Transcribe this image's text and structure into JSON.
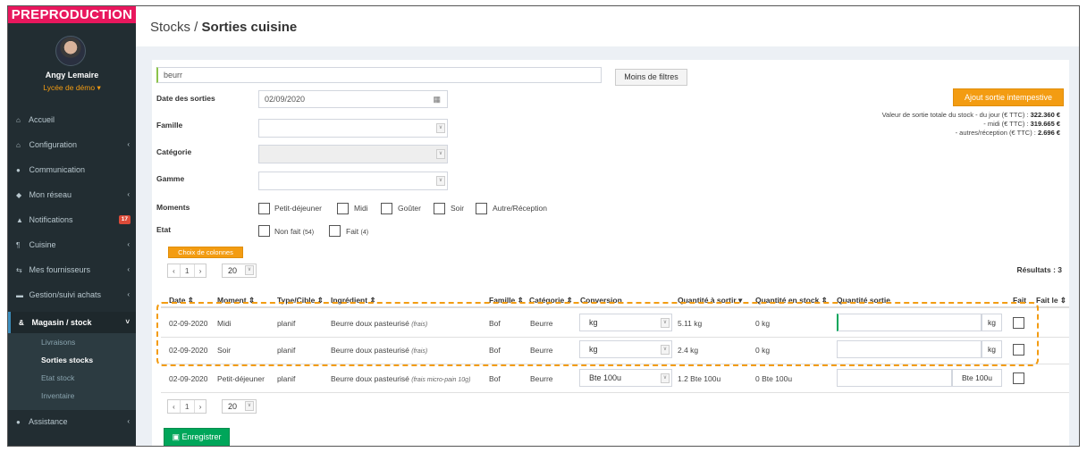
{
  "env_banner": "PREPRODUCTION",
  "user": {
    "name": "Angy Lemaire",
    "school": "Lycée de démo ▾"
  },
  "nav": [
    {
      "key": "accueil",
      "icon": "⌂",
      "label": "Accueil",
      "chevron": ""
    },
    {
      "key": "configuration",
      "icon": "⌂",
      "label": "Configuration",
      "chevron": "‹"
    },
    {
      "key": "communication",
      "icon": "●",
      "label": "Communication",
      "chevron": ""
    },
    {
      "key": "reseau",
      "icon": "◆",
      "label": "Mon réseau",
      "chevron": "‹"
    },
    {
      "key": "notifications",
      "icon": "▲",
      "label": "Notifications",
      "chevron": "",
      "badge": "17"
    },
    {
      "key": "cuisine",
      "icon": "¶",
      "label": "Cuisine",
      "chevron": "‹"
    },
    {
      "key": "fournisseurs",
      "icon": "⇆",
      "label": "Mes fournisseurs",
      "chevron": "‹"
    },
    {
      "key": "achats",
      "icon": "▬",
      "label": "Gestion/suivi achats",
      "chevron": "‹"
    },
    {
      "key": "magasin",
      "icon": "&",
      "label": "Magasin / stock",
      "chevron": "˅"
    },
    {
      "key": "assistance",
      "icon": "●",
      "label": "Assistance",
      "chevron": "‹"
    }
  ],
  "submenu": [
    "Livraisons",
    "Sorties stocks",
    "Etat stock",
    "Inventaire"
  ],
  "page": {
    "section": "Stocks / ",
    "title": "Sorties cuisine"
  },
  "filters": {
    "search_value": "beurr",
    "less_filters": "Moins de filtres",
    "date_label": "Date des sorties",
    "date_value": "02/09/2020",
    "famille_label": "Famille",
    "categorie_label": "Catégorie",
    "gamme_label": "Gamme",
    "moments_label": "Moments",
    "moments": [
      "Petit-déjeuner",
      "Midi",
      "Goûter",
      "Soir",
      "Autre/Réception"
    ],
    "etat_label": "Etat",
    "etat_non_fait": "Non fait",
    "etat_non_fait_count": "(54)",
    "etat_fait": "Fait",
    "etat_fait_count": "(4)"
  },
  "add_button": "Ajout sortie intempestive",
  "valuation": {
    "line1_label": "Valeur de sortie totale du stock - du jour (€ TTC) : ",
    "line1_value": "322.360 €",
    "line2_label": "- midi (€ TTC) : ",
    "line2_value": "319.665 €",
    "line3_label": "- autres/réception (€ TTC) : ",
    "line3_value": "2.696 €"
  },
  "columns_button": "Choix de colonnes",
  "pager": {
    "prev": "‹",
    "page": "1",
    "next": "›",
    "page_size": "20"
  },
  "results": "Résultats : 3",
  "table": {
    "headers": [
      "Date ⇕",
      "Moment ⇕",
      "Type/Cible ⇕",
      "Ingrédient ⇕",
      "Famille ⇕",
      "Catégorie ⇕",
      "Conversion",
      "Quantité à sortir ▾",
      "Quantité en stock ⇕",
      "Quantité sortie",
      "Fait",
      "Fait le ⇕"
    ],
    "rows": [
      {
        "date": "02-09-2020",
        "moment": "Midi",
        "type": "planif",
        "ingredient": "Beurre doux pasteurisé",
        "note": "(frais)",
        "famille": "Bof",
        "categorie": "Beurre",
        "conversion": "kg",
        "qty_out": "5.11 kg",
        "qty_stock": "0 kg",
        "unit": "kg"
      },
      {
        "date": "02-09-2020",
        "moment": "Soir",
        "type": "planif",
        "ingredient": "Beurre doux pasteurisé",
        "note": "(frais)",
        "famille": "Bof",
        "categorie": "Beurre",
        "conversion": "kg",
        "qty_out": "2.4 kg",
        "qty_stock": "0 kg",
        "unit": "kg"
      },
      {
        "date": "02-09-2020",
        "moment": "Petit-déjeuner",
        "type": "planif",
        "ingredient": "Beurre doux pasteurisé",
        "note": "(frais micro-pain 10g)",
        "famille": "Bof",
        "categorie": "Beurre",
        "conversion": "Bte 100u",
        "qty_out": "1.2 Bte 100u",
        "qty_stock": "0 Bte 100u",
        "unit": "Bte 100u"
      }
    ]
  },
  "save_button": "Enregistrer"
}
